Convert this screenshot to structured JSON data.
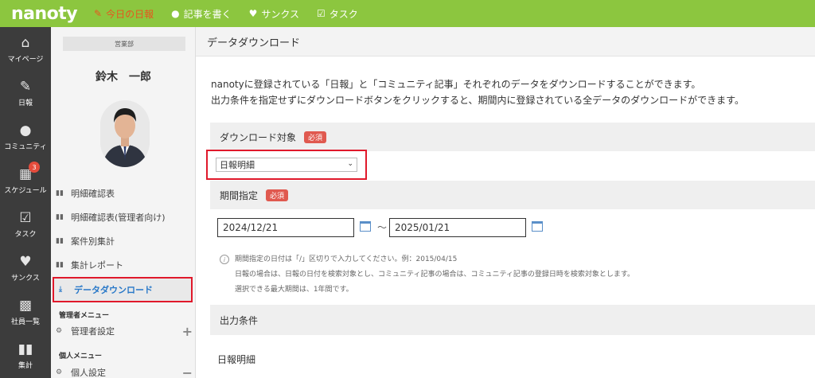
{
  "topbar": {
    "logo": "nanoty",
    "nav": [
      {
        "label": "今日の日報",
        "icon": "edit-icon",
        "active": true
      },
      {
        "label": "記事を書く",
        "icon": "chat-icon"
      },
      {
        "label": "サンクス",
        "icon": "heart-icon"
      },
      {
        "label": "タスク",
        "icon": "clipboard-icon"
      }
    ]
  },
  "iconbar": {
    "items": [
      {
        "label": "マイページ",
        "icon": "home-icon"
      },
      {
        "label": "日報",
        "icon": "report-icon"
      },
      {
        "label": "コミュニティ",
        "icon": "chat-icon"
      },
      {
        "label": "スケジュール",
        "icon": "calendar-icon",
        "badge": "3"
      },
      {
        "label": "タスク",
        "icon": "task-icon"
      },
      {
        "label": "サンクス",
        "icon": "heart-icon"
      },
      {
        "label": "社員一覧",
        "icon": "directory-icon"
      },
      {
        "label": "集計",
        "icon": "bar-chart-icon"
      }
    ]
  },
  "profile": {
    "department": "営業部",
    "name": "鈴木　一郎"
  },
  "menu": {
    "items": [
      {
        "label": "明細確認表"
      },
      {
        "label": "明細確認表(管理者向け)"
      },
      {
        "label": "案件別集計"
      },
      {
        "label": "集計レポート"
      },
      {
        "label": "データダウンロード",
        "active": true
      }
    ],
    "admin_header": "管理者メニュー",
    "admin_settings": "管理者設定",
    "personal_header": "個人メニュー",
    "personal_settings": "個人設定"
  },
  "main": {
    "title": "データダウンロード",
    "desc_line1": "nanotyに登録されている「日報」と「コミュニティ記事」それぞれのデータをダウンロードすることができます。",
    "desc_line2": "出力条件を指定せずにダウンロードボタンをクリックすると、期間内に登録されている全データのダウンロードができます。",
    "target_label": "ダウンロード対象",
    "required": "必須",
    "target_value": "日報明細",
    "period_label": "期間指定",
    "date_from": "2024/12/21",
    "date_to": "2025/01/21",
    "tilde": "～",
    "note1": "期間指定の日付は「/」区切りで入力してください。例：2015/04/15",
    "note2": "日報の場合は、日報の日付を検索対象とし、コミュニティ記事の場合は、コミュニティ記事の登録日時を検索対象とします。",
    "note3": "選択できる最大期間は、1年間です。",
    "output_label": "出力条件",
    "sub_label": "日報明細"
  },
  "colors": {
    "topbar": "#8cc63f",
    "active_nav": "#e8541e",
    "required_badge": "#e0594f",
    "highlight_border": "#e0192b",
    "link_blue": "#2878c8"
  }
}
